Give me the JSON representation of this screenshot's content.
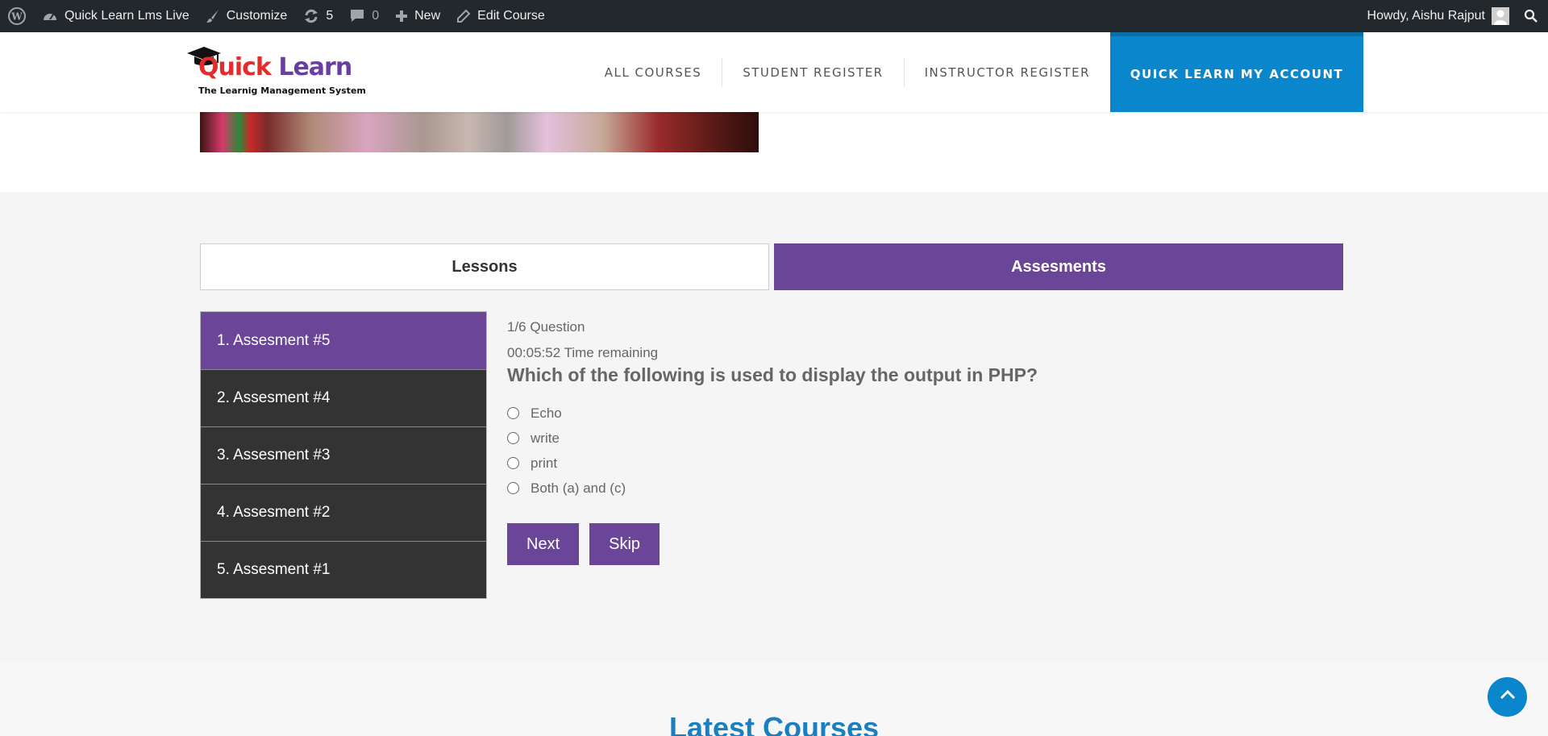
{
  "adminbar": {
    "site_name": "Quick Learn Lms Live",
    "customize": "Customize",
    "updates_count": "5",
    "comments_count": "0",
    "new_label": "New",
    "edit_course": "Edit Course",
    "howdy": "Howdy, Aishu Rajput"
  },
  "header": {
    "logo_quick": "Quick",
    "logo_learn": "Learn",
    "logo_tagline": "The Learnig Management System",
    "nav": [
      "ALL COURSES",
      "STUDENT REGISTER",
      "INSTRUCTOR REGISTER"
    ],
    "cta": "QUICK LEARN MY ACCOUNT"
  },
  "tabs": {
    "lessons": "Lessons",
    "assessments": "Assesments"
  },
  "assessments": [
    {
      "label": "1. Assesment #5",
      "active": true
    },
    {
      "label": "2. Assesment #4",
      "active": false
    },
    {
      "label": "3. Assesment #3",
      "active": false
    },
    {
      "label": "4. Assesment #2",
      "active": false
    },
    {
      "label": "5. Assesment #1",
      "active": false
    }
  ],
  "quiz": {
    "progress": "1/6 Question",
    "timer": "00:05:52 Time remaining",
    "question": "Which of the following is used to display the output in PHP?",
    "options": [
      "Echo",
      "write",
      "print",
      "Both (a) and (c)"
    ],
    "next": "Next",
    "skip": "Skip"
  },
  "latest_courses": "Latest Courses",
  "colors": {
    "purple": "#6a4598",
    "blue": "#0a86cc",
    "dark": "#333333",
    "adminbar": "#23282d"
  }
}
